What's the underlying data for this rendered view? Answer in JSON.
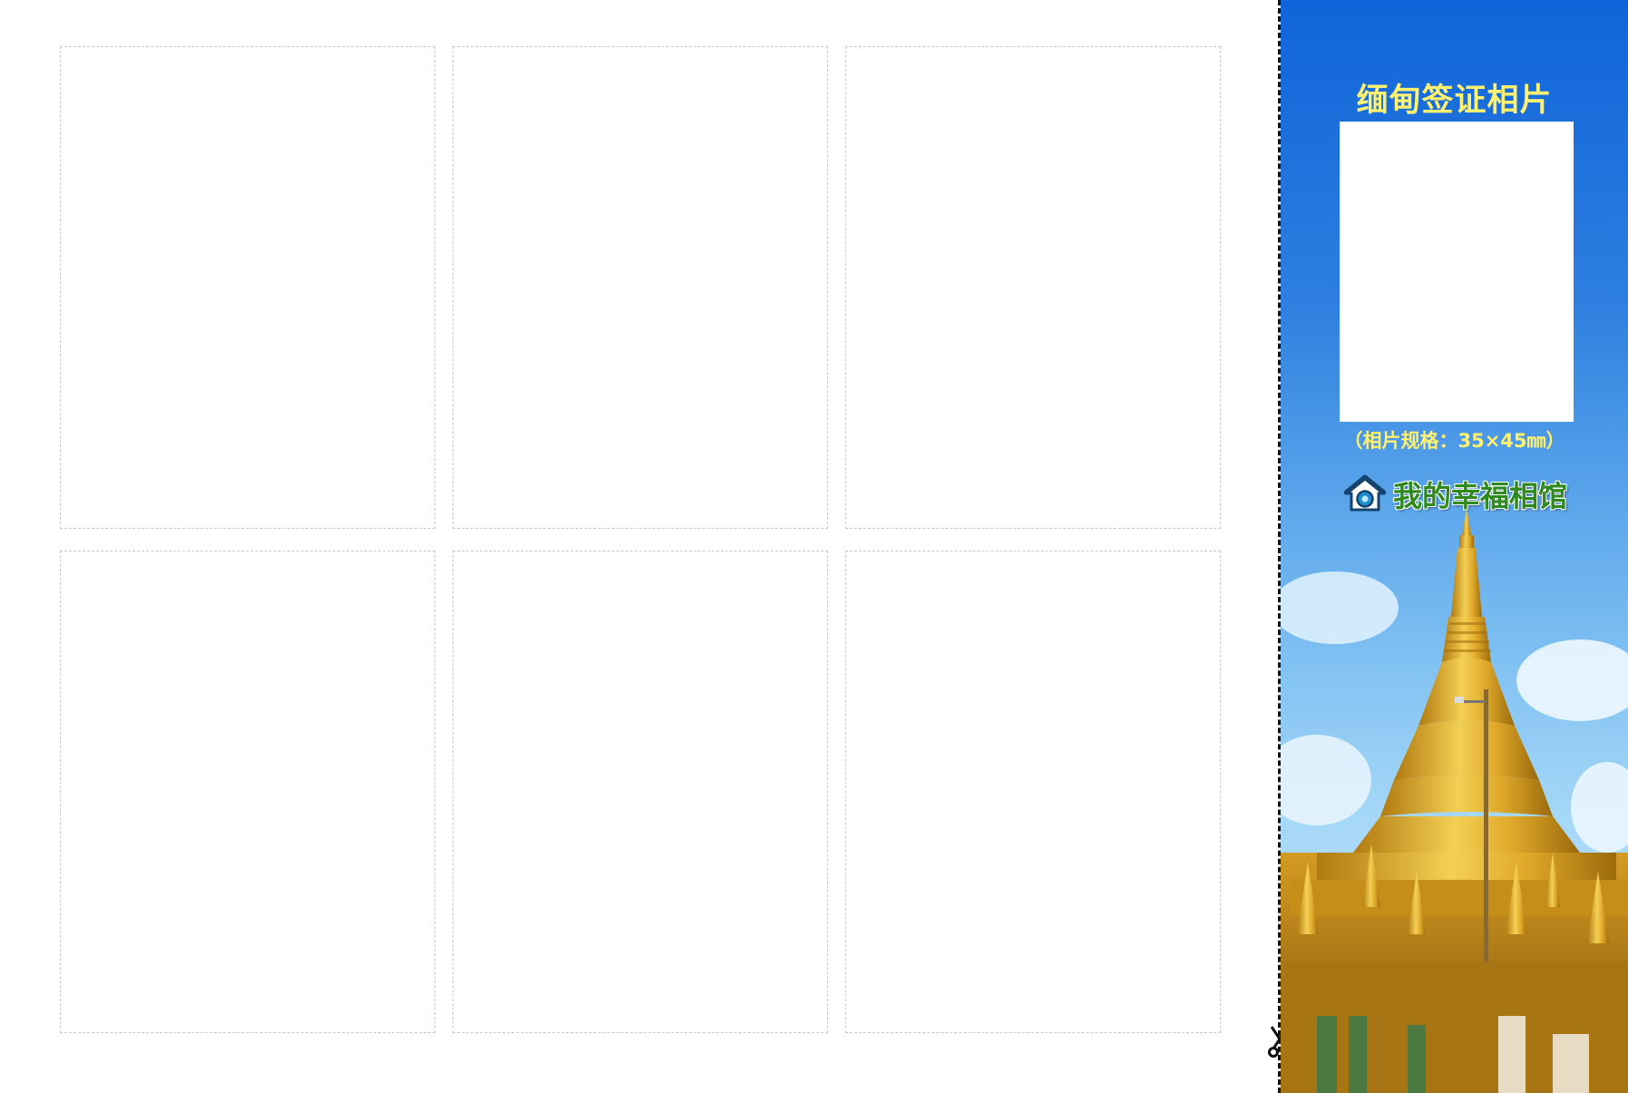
{
  "panel": {
    "title": "缅甸签证相片",
    "photo_spec": "（相片规格：35×45㎜）",
    "brand_name": "我的幸福相馆",
    "brand_icon": "house-camera-icon",
    "scissors_icon": "scissors-icon",
    "colors": {
      "title": "#fff170",
      "sky_top": "#0f64d9",
      "sky_bottom": "#b8e2fa",
      "brand_text": "#2f8a1e",
      "gold": "#d9a520"
    }
  },
  "photo_slots": [
    "",
    "",
    "",
    "",
    "",
    ""
  ]
}
